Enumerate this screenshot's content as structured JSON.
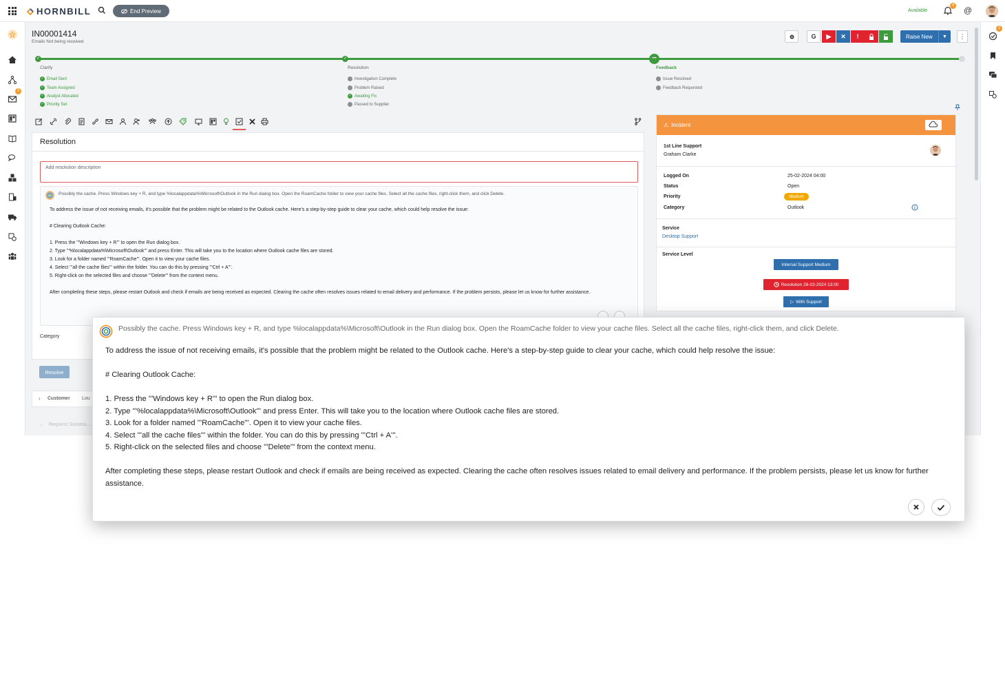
{
  "topbar": {
    "brand": "HORNBILL",
    "preview_label": "End Preview",
    "availability": "Available",
    "notifications_count": "4"
  },
  "leftnav": {
    "mail_badge": "3"
  },
  "rightnav": {
    "tasks_badge": "2"
  },
  "request": {
    "id": "IN00001414",
    "summary": "Emails Not being received",
    "raise_label": "Raise New"
  },
  "progress": {
    "stages": [
      {
        "title": "Clarify",
        "items": [
          "Email Sent",
          "Team Assigned",
          "Analyst Allocated",
          "Priority Set"
        ]
      },
      {
        "title": "Resolution",
        "items": [
          "Investigation Complete",
          "Problem Raised",
          "Awaiting Fix",
          "Passed to Supplier"
        ]
      },
      {
        "title": "Feedback",
        "items": [
          "Issue Resolved",
          "Feedback Requested"
        ]
      }
    ]
  },
  "resolution": {
    "title": "Resolution",
    "placeholder": "Add resolution description",
    "category_label": "Category",
    "resolve_label": "Resolve",
    "customer_label": "Customer",
    "customer_value": "Lou",
    "request_summary_label": "Request Summa..."
  },
  "suggestion": {
    "headline": "Possibly the cache. Press Windows key + R, and type %localappdata%\\Microsoft\\Outlook in the Run dialog box. Open the RoamCache folder to view your cache files. Select all the cache files, right-click them, and click Delete.",
    "intro": "To address the issue of not receiving emails, it's possible that the problem might be related to the Outlook cache. Here's a step-by-step guide to clear your cache, which could help resolve the issue:",
    "heading": "# Clearing Outlook Cache:",
    "steps": [
      "1. Press the '''Windows key + R''' to open the Run dialog box.",
      "2. Type '''%localappdata%\\Microsoft\\Outlook''' and press Enter. This will take you to the location where Outlook cache files are stored.",
      "3. Look for a folder named '''RoamCache'''. Open it to view your cache files.",
      "4. Select '''all the cache files''' within the folder. You can do this by pressing '''Ctrl + A'''.",
      "5. Right-click on the selected files and choose '''Delete''' from the context menu."
    ],
    "closing": "After completing these steps, please restart Outlook and check if emails are being received as expected. Clearing the cache often resolves issues related to email delivery and performance. If the problem persists, please let us know for further assistance."
  },
  "incident": {
    "header": "Incident",
    "team": "1st Line Support",
    "owner": "Graham Clarke",
    "logged_on_label": "Logged On",
    "logged_on": "25-02-2024 04:00",
    "status_label": "Status",
    "status": "Open",
    "priority_label": "Priority",
    "priority": "Medium",
    "category_label": "Category",
    "category": "Outlook",
    "service_label": "Service",
    "service": "Desktop Support",
    "service_level_label": "Service Level",
    "sla_name": "Internal Support Medium",
    "sla_resolution": "Resolution 26-02-2024 13:00",
    "sla_state": "With Support"
  },
  "colors": {
    "accent": "#2f6fad",
    "success": "#3d9a3d",
    "incident": "#f4943f",
    "danger": "#e0232e",
    "warning": "#f1a800"
  }
}
